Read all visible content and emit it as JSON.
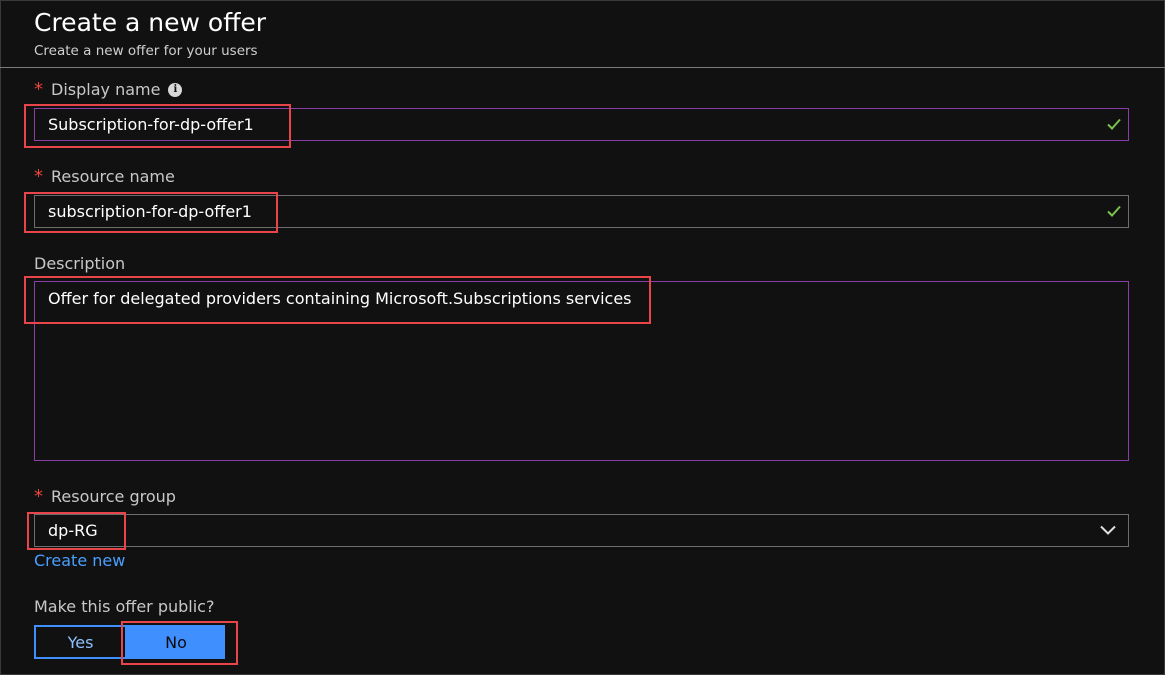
{
  "header": {
    "title": "Create a new offer",
    "subtitle": "Create a new offer for your users"
  },
  "display_name": {
    "label": "Display name",
    "value": "Subscription-for-dp-offer1",
    "valid": true
  },
  "resource_name": {
    "label": "Resource name",
    "value": "subscription-for-dp-offer1",
    "valid": true
  },
  "description": {
    "label": "Description",
    "value": "Offer for delegated providers containing Microsoft.Subscriptions services"
  },
  "resource_group": {
    "label": "Resource group",
    "selected": "dp-RG",
    "create_new_label": "Create new"
  },
  "public_offer": {
    "label": "Make this offer public?",
    "yes_label": "Yes",
    "no_label": "No",
    "selected": "No"
  },
  "colors": {
    "background": "#111111",
    "accent": "#3f8fff",
    "required": "#e8453c",
    "focus_border": "#8c3ea8",
    "highlight": "#e8444a",
    "valid_check": "#7cc24a"
  },
  "icons": [
    "info-icon",
    "checkmark-icon",
    "chevron-down-icon"
  ]
}
